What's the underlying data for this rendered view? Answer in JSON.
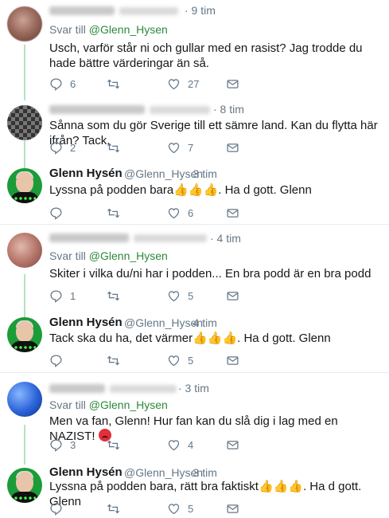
{
  "tweets": [
    {
      "time": "· 9 tim",
      "reply_prefix": "Svar till ",
      "reply_handle": "@Glenn_Hysen",
      "text": "Usch, varför står ni och gullar med en rasist? Jag trodde du hade bättre värderingar än så.",
      "replies": "6",
      "retweets": "",
      "likes": "27"
    },
    {
      "time": "· 8 tim",
      "text": "Sånna som du gör Sverige till ett sämre land. Kan du flytta här ifrån? Tack.",
      "replies": "2",
      "retweets": "",
      "likes": "7"
    },
    {
      "name": "Glenn Hysén",
      "handle": "@Glenn_Hysen",
      "time": "· 3 tim",
      "text_before": "Lyssna på podden bara",
      "thumbs": "👍👍👍",
      "text_after": ". Ha d gott. Glenn",
      "replies": "",
      "retweets": "",
      "likes": "6"
    },
    {
      "time": "· 4 tim",
      "reply_prefix": "Svar till ",
      "reply_handle": "@Glenn_Hysen",
      "text": "Skiter i vilka du/ni har i podden... En bra podd är en bra podd",
      "replies": "1",
      "retweets": "",
      "likes": "5"
    },
    {
      "name": "Glenn Hysén",
      "handle": "@Glenn_Hysen",
      "time": "· 4 tim",
      "text_before": "Tack ska du ha, det värmer",
      "thumbs": "👍👍👍",
      "text_after": ". Ha d gott. Glenn",
      "replies": "",
      "retweets": "",
      "likes": "5"
    },
    {
      "time": "· 3 tim",
      "reply_prefix": "Svar till ",
      "reply_handle": "@Glenn_Hysen",
      "text": "Men va fan, Glenn! Hur fan kan du slå dig i lag med en NAZIST! ",
      "replies": "3",
      "retweets": "",
      "likes": "4"
    },
    {
      "name": "Glenn Hysén",
      "handle": "@Glenn_Hysen",
      "time": "· 3 tim",
      "text_before": "Lyssna på podden bara, rätt bra faktiskt",
      "thumbs": "👍👍👍",
      "text_after": ". Ha d gott. Glenn",
      "replies": "",
      "retweets": "",
      "likes": "5"
    }
  ],
  "colors": {
    "accent_link": "#2a8a3a",
    "icon_gray": "#657786",
    "thread_line": "#b6e3c1",
    "glenn_avatar": "#1b9c38"
  },
  "icons": [
    "reply-icon",
    "retweet-icon",
    "like-icon",
    "message-icon"
  ]
}
